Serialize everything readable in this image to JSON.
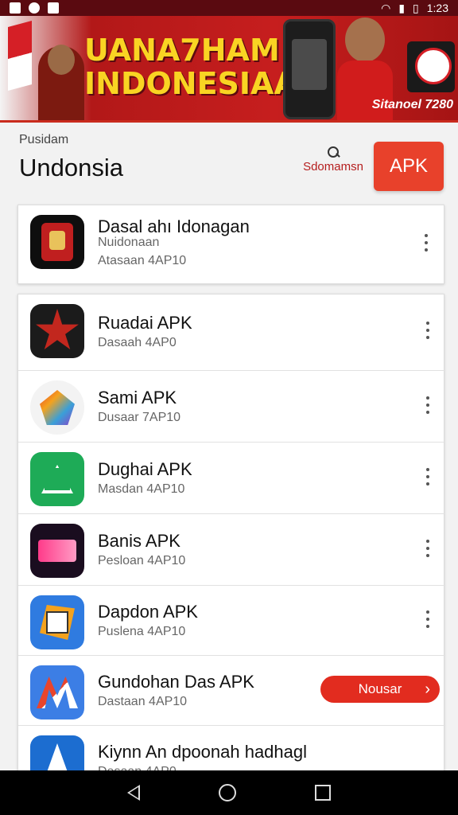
{
  "status_bar": {
    "time": "1:23"
  },
  "banner": {
    "title_line1": "UANA7HAM",
    "title_line2": "INDONESIAA",
    "caption": "Sitanoel 7280"
  },
  "header": {
    "subtitle": "Pusidam",
    "title": "Undonsia",
    "search_label": "Sdomamsn",
    "apk_button": "APK"
  },
  "featured": {
    "name": "Dasal ahı Idonagan",
    "developer": "Nuidonaan",
    "meta": "Atasaan 4AP10"
  },
  "apps": [
    {
      "name": "Ruadai APK",
      "meta": "Dasaah 4AP0",
      "icon": "star-badge-icon",
      "color": "#c2271e"
    },
    {
      "name": "Sami APK",
      "meta": "Dusaar 7AP10",
      "icon": "prism-cube-icon",
      "color": "#f4a21d"
    },
    {
      "name": "Dughai APK",
      "meta": "Masdan 4AP10",
      "icon": "ad-letter-icon",
      "color": "#1eab57"
    },
    {
      "name": "Banis APK",
      "meta": "Pesloan 4AP10",
      "icon": "ab-letter-icon",
      "color": "#1a0d1f"
    },
    {
      "name": "Dapdon APK",
      "meta": "Puslena 4AP10",
      "icon": "globe-frame-icon",
      "color": "#2f7be0"
    },
    {
      "name": "Gundohan Das APK",
      "meta": "Dastaan 4AP10",
      "icon": "zigzag-icon",
      "color": "#3c7ee5",
      "button": "Nousar"
    },
    {
      "name": "Kiynn An dpoonah hadhagl",
      "meta": "Desaan 4AP0",
      "icon": "tower-icon",
      "color": "#1c6dd0"
    }
  ]
}
